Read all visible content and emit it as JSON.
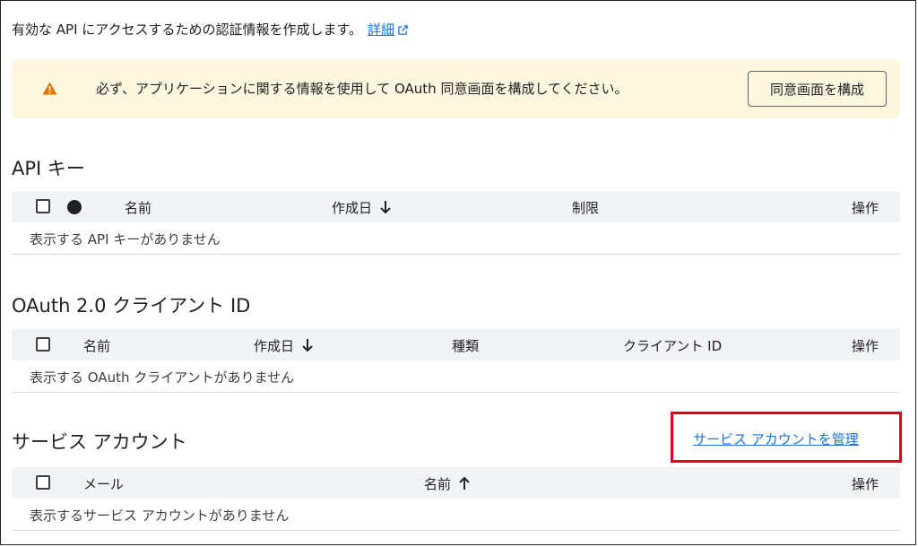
{
  "intro": {
    "text": "有効な API にアクセスするための認証情報を作成します。",
    "link": "詳細"
  },
  "banner": {
    "text": "必ず、アプリケーションに関する情報を使用して OAuth 同意画面を構成してください。",
    "button": "同意画面を構成"
  },
  "api_keys": {
    "title": "API キー",
    "columns": [
      "名前",
      "作成日",
      "制限",
      "操作"
    ],
    "empty": "表示する API キーがありません"
  },
  "oauth": {
    "title": "OAuth 2.0 クライアント ID",
    "columns": [
      "名前",
      "作成日",
      "種類",
      "クライアント ID",
      "操作"
    ],
    "empty": "表示する OAuth クライアントがありません"
  },
  "service_accounts": {
    "title": "サービス アカウント",
    "manage_link": "サービス アカウントを管理",
    "columns": [
      "メール",
      "名前",
      "操作"
    ],
    "empty": "表示するサービス アカウントがありません"
  },
  "colors": {
    "link": "#1a73e8",
    "warning": "#e37400",
    "highlight": "#e2001a",
    "banner_bg": "#fef7e0"
  },
  "icons": [
    "open-in-new-icon",
    "warning-icon",
    "arrow-down-icon",
    "arrow-up-icon",
    "checkbox-icon"
  ]
}
